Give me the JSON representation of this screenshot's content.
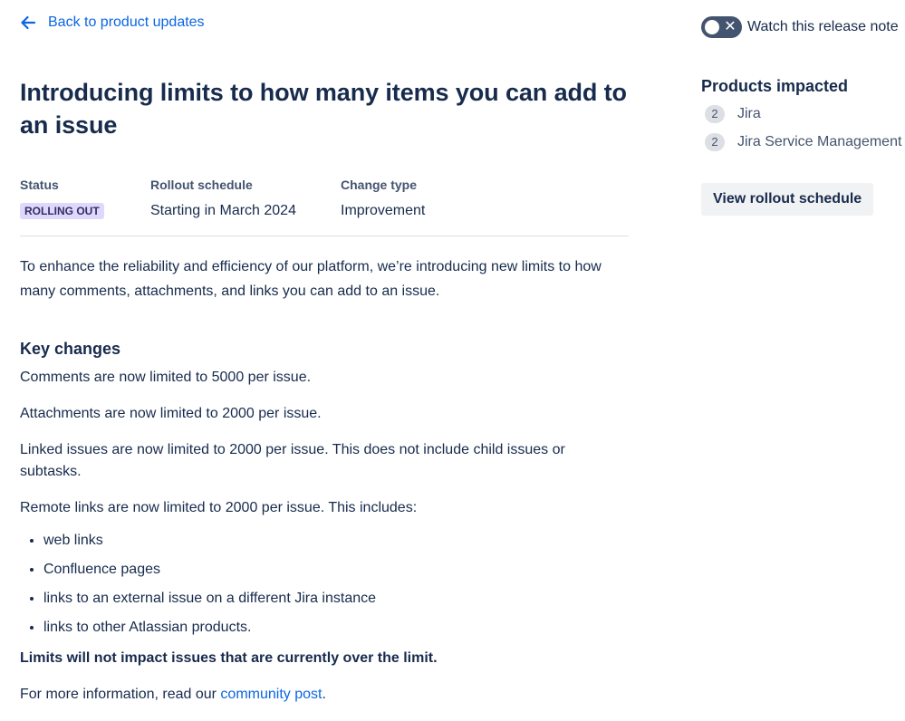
{
  "back_link": {
    "label": "Back to product updates",
    "icon": "arrow-left-icon"
  },
  "title": "Introducing limits to how many items you can add to an issue",
  "meta": {
    "status_label": "Status",
    "status_value": "ROLLING OUT",
    "rollout_label": "Rollout schedule",
    "rollout_value": "Starting in March 2024",
    "change_label": "Change type",
    "change_value": "Improvement"
  },
  "intro": "To enhance the reliability and efficiency of our platform, we’re introducing new limits to how many comments, attachments, and links you can add to an issue.",
  "key_changes": {
    "heading": "Key changes",
    "paragraphs": [
      "Comments are now limited to 5000 per issue.",
      "Attachments are now limited to 2000 per issue.",
      "Linked issues are now limited to 2000 per issue. This does not include child issues or subtasks.",
      "Remote links are now limited to 2000 per issue. This includes:"
    ],
    "bullets": [
      "web links",
      "Confluence pages",
      "links to an external issue on a different Jira instance",
      "links to other Atlassian products."
    ],
    "bold_note": "Limits will not impact issues that are currently over the limit.",
    "more_info_prefix": "For more information, read our ",
    "more_info_link": "community post",
    "more_info_suffix": "."
  },
  "sidebar": {
    "watch_label": "Watch this release note",
    "watch_toggle_on": false,
    "products_title": "Products impacted",
    "products": [
      {
        "count": "2",
        "name": "Jira"
      },
      {
        "count": "2",
        "name": "Jira Service Management"
      }
    ],
    "rollout_button": "View rollout schedule"
  },
  "colors": {
    "link": "#0c66e4",
    "text": "#172b4d",
    "status_bg": "#dfd8fd",
    "status_text": "#352c63"
  }
}
